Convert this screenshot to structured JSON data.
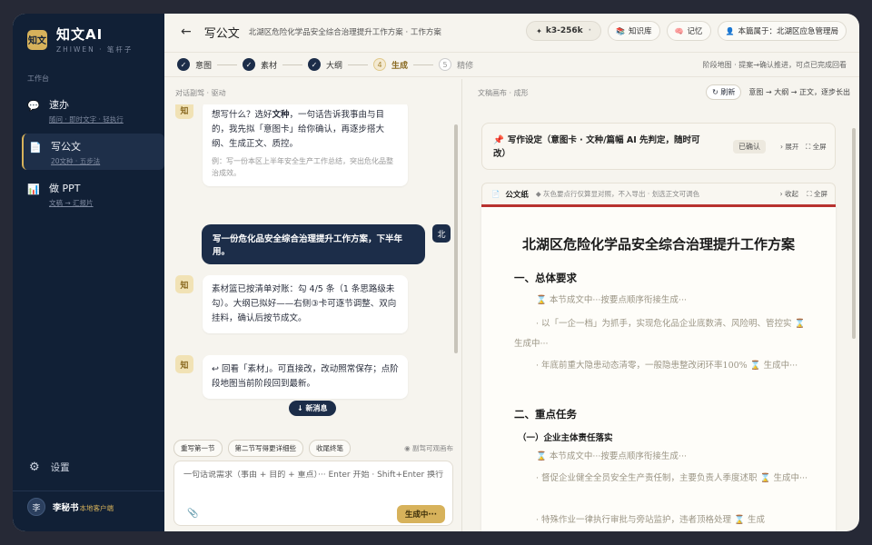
{
  "brand": {
    "logo_text": "知文",
    "title": "知文AI",
    "subtitle": "ZHIWEN · 笔杆子"
  },
  "sidebar": {
    "section_label": "工作台",
    "items": [
      {
        "title": "速办",
        "sub": "随问 · 即时文字 · 轻执行",
        "icon": "speech-bubble-icon"
      },
      {
        "title": "写公文",
        "sub": "20文种 · 五步法",
        "icon": "document-icon"
      },
      {
        "title": "做 PPT",
        "sub": "文稿 → 汇报片",
        "icon": "presentation-icon"
      }
    ],
    "settings_label": "设置",
    "user": {
      "avatar": "李",
      "name": "李秘书",
      "tag": "本地客户端"
    }
  },
  "topbar": {
    "back": "←",
    "title": "写公文",
    "breadcrumb": "北湖区危险化学品安全综合治理提升工作方案 · 工作方案",
    "model": "k3-256k",
    "model_icon": "✦",
    "knowledge": "知识库",
    "memory": "记忆",
    "owner": "本篇属于：北湖区应急管理局"
  },
  "steps": {
    "items": [
      {
        "num": "✓",
        "label": "意图",
        "state": "done"
      },
      {
        "num": "✓",
        "label": "素材",
        "state": "done"
      },
      {
        "num": "✓",
        "label": "大纲",
        "state": "done"
      },
      {
        "num": "4",
        "label": "生成",
        "state": "current"
      },
      {
        "num": "5",
        "label": "精修",
        "state": "todo"
      }
    ],
    "hint": "阶段地图 · 提案→确认推进，可点已完成回看"
  },
  "chat": {
    "pane_label": "对话副驾 · 驱动",
    "msg1": {
      "avatar": "知",
      "pre": "想写什么？选好",
      "bold": "文种",
      "post": "，一句话告诉我事由与目的，我先拟「意图卡」给你确认，再逐步搭大纲、生成正文、质控。",
      "example": "例：写一份本区上半年安全生产工作总结，突出危化品整治成效。"
    },
    "user_msg": {
      "avatar": "北",
      "text": "写一份危化品安全综合治理提升工作方案，下半年用。"
    },
    "msg2": {
      "avatar": "知",
      "text": "素材篮已按清单对账：勾 4/5 条（1 条思路级未勾）。大纲已拟好——右侧③卡可逐节调整、双向挂料，确认后按节成文。"
    },
    "msg3": {
      "avatar": "知",
      "text": "↩ 回看「素材」。可直接改，改动照常保存；点阶段地图当前阶段回到最新。"
    },
    "new_msg": "↓ 新消息",
    "chips": [
      "重写第一节",
      "第二节写得更详细些",
      "收尾终笔"
    ],
    "chip_hint": "◉ 副驾可观画布",
    "input_placeholder": "一句话说需求（事由 + 目的 + 重点）··· Enter 开始 · Shift+Enter 换行",
    "generate": "生成中···"
  },
  "doc": {
    "pane_label": "文稿画布 · 成形",
    "refresh": "↻ 刷新",
    "flow": "意图 → 大纲 → 正文，逐步长出",
    "settings_card": {
      "text": "写作设定（意图卡 · 文种/篇幅 AI 先判定，随时可改）",
      "status": "已确认",
      "expand": "› 展开",
      "fullscreen": "⛶ 全屏"
    },
    "paper_bar": {
      "title": "公文纸",
      "hint": "◆ 灰色要点行仅算显对照，不入导出 · 划选正文可调色",
      "collapse": "› 收起",
      "fullscreen": "⛶ 全屏"
    },
    "title": "北湖区危险化学品安全综合治理提升工作方案",
    "section1": "一、总体要求",
    "p1": "本节成文中···按要点顺序衔接生成···",
    "p2a": "以「一企一档」为抓手，实现危化品企业底数清、风险明、管控实",
    "p2b": "生成中···",
    "p3a": "年底前重大隐患动态清零，一般隐患整改闭环率100%",
    "p3b": "生成中···",
    "section2": "二、重点任务",
    "sub1": "（一）企业主体责任落实",
    "p4": "本节成文中···按要点顺序衔接生成···",
    "p5a": "督促企业健全全员安全生产责任制，主要负责人季度述职",
    "p5b": "生成中···",
    "p6a": "特殊作业一律执行审批与旁站监护，违者顶格处理",
    "p6b": "生成"
  }
}
